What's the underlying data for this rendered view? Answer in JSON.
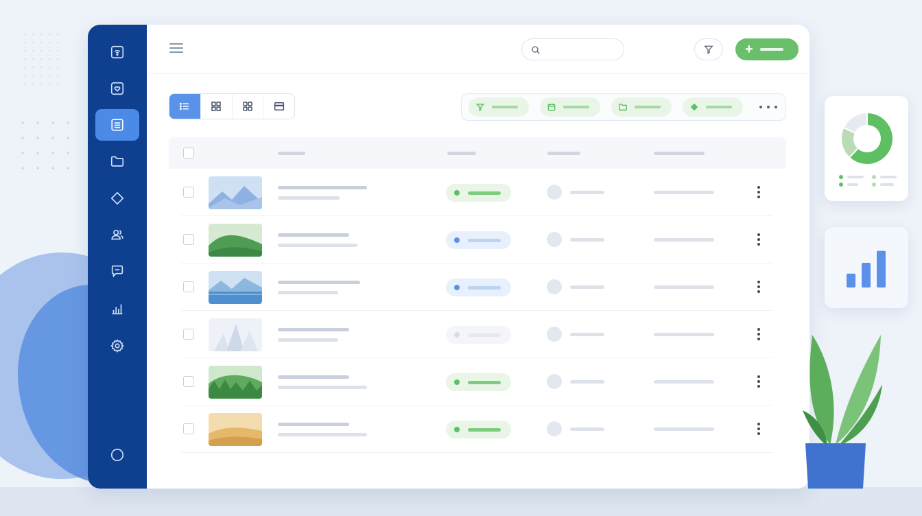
{
  "topbar": {
    "search": {
      "placeholder": "",
      "value": ""
    }
  },
  "sidebar": {
    "items": [
      {
        "icon": "wifi-card-icon",
        "active": false
      },
      {
        "icon": "heart-card-icon",
        "active": false
      },
      {
        "icon": "list-document-icon",
        "active": true
      },
      {
        "icon": "folder-icon",
        "active": false
      },
      {
        "icon": "tag-icon",
        "active": false
      },
      {
        "icon": "users-icon",
        "active": false
      },
      {
        "icon": "chat-icon",
        "active": false
      },
      {
        "icon": "bar-chart-icon",
        "active": false
      },
      {
        "icon": "gear-icon",
        "active": false
      },
      {
        "icon": "circle-icon",
        "active": false
      }
    ]
  },
  "view_modes": [
    {
      "icon": "list-view-icon",
      "active": true
    },
    {
      "icon": "grid-view-icon",
      "active": false
    },
    {
      "icon": "gallery-view-icon",
      "active": false
    },
    {
      "icon": "card-view-icon",
      "active": false
    }
  ],
  "filter_chips": [
    {
      "icon": "filter-icon"
    },
    {
      "icon": "calendar-icon"
    },
    {
      "icon": "folder-icon"
    },
    {
      "icon": "tag-icon"
    }
  ],
  "table": {
    "rows": [
      {
        "thumbnail": "blue-mountains",
        "status": "green"
      },
      {
        "thumbnail": "green-hills",
        "status": "blue"
      },
      {
        "thumbnail": "lake",
        "status": "blue"
      },
      {
        "thumbnail": "pale-mountains",
        "status": "gray"
      },
      {
        "thumbnail": "forest",
        "status": "green"
      },
      {
        "thumbnail": "desert",
        "status": "green"
      }
    ]
  },
  "colors": {
    "sidebar": "#0f3f8f",
    "accent": "#4c8ae8",
    "primary_action": "#6abf6b",
    "status_green": "#5fbf63",
    "status_blue": "#5b91e8",
    "status_gray": "#d7dde7"
  },
  "widgets": {
    "donut": {
      "segments": [
        0.62,
        0.2,
        0.18
      ]
    },
    "bars": [
      0.35,
      0.62,
      0.92
    ]
  }
}
